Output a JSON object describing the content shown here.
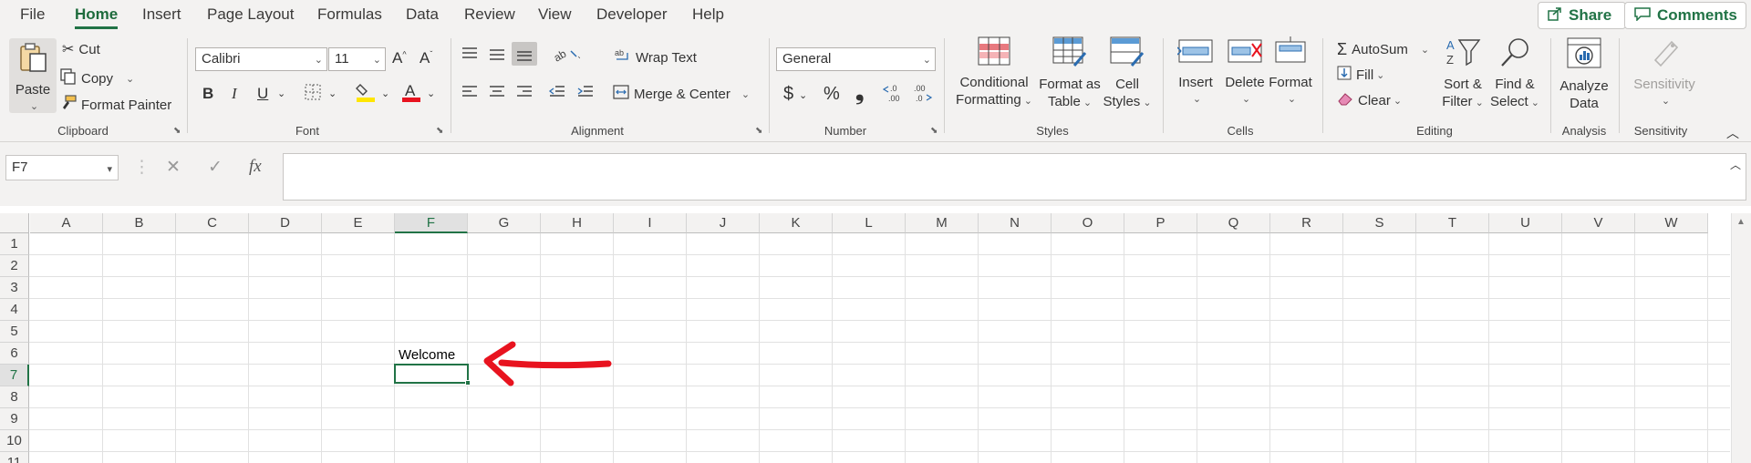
{
  "menu": {
    "tabs": [
      "File",
      "Home",
      "Insert",
      "Page Layout",
      "Formulas",
      "Data",
      "Review",
      "View",
      "Developer",
      "Help"
    ],
    "active_tab": "Home",
    "share_label": "Share",
    "comments_label": "Comments"
  },
  "ribbon": {
    "clipboard": {
      "paste": "Paste",
      "cut": "Cut",
      "copy": "Copy",
      "format_painter": "Format Painter",
      "label": "Clipboard"
    },
    "font": {
      "name": "Calibri",
      "size": "11",
      "label": "Font",
      "bold": "B",
      "italic": "I",
      "underline": "U"
    },
    "alignment": {
      "wrap_text": "Wrap Text",
      "merge_center": "Merge & Center",
      "label": "Alignment"
    },
    "number": {
      "format": "General",
      "label": "Number",
      "currency": "$",
      "percent": "%",
      "comma": "❟"
    },
    "styles": {
      "conditional_formatting_1": "Conditional",
      "conditional_formatting_2": "Formatting",
      "format_as_table_1": "Format as",
      "format_as_table_2": "Table",
      "cell_styles_1": "Cell",
      "cell_styles_2": "Styles",
      "label": "Styles"
    },
    "cells": {
      "insert": "Insert",
      "delete": "Delete",
      "format": "Format",
      "label": "Cells"
    },
    "editing": {
      "autosum": "AutoSum",
      "fill": "Fill",
      "clear": "Clear",
      "sort_filter_1": "Sort &",
      "sort_filter_2": "Filter",
      "find_select_1": "Find &",
      "find_select_2": "Select",
      "label": "Editing"
    },
    "analysis": {
      "analyze_1": "Analyze",
      "analyze_2": "Data",
      "label": "Analysis"
    },
    "sensitivity": {
      "button": "Sensitivity",
      "label": "Sensitivity"
    }
  },
  "formula_bar": {
    "name_box": "F7",
    "formula": "",
    "fx": "fx"
  },
  "sheet": {
    "columns": [
      "A",
      "B",
      "C",
      "D",
      "E",
      "F",
      "G",
      "H",
      "I",
      "J",
      "K",
      "L",
      "M",
      "N",
      "O",
      "P",
      "Q",
      "R",
      "S",
      "T",
      "U",
      "V",
      "W"
    ],
    "rows": [
      "1",
      "2",
      "3",
      "4",
      "5",
      "6",
      "7",
      "8",
      "9",
      "10",
      "11"
    ],
    "selected_column": "F",
    "selected_row": "7",
    "cells": {
      "F6": "Welcome"
    }
  },
  "colors": {
    "accent": "#217346",
    "annotation_arrow": "#e8131f"
  }
}
